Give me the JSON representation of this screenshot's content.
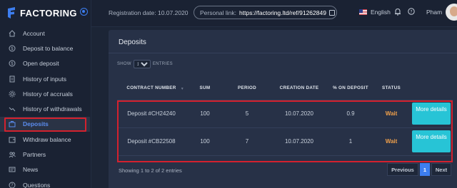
{
  "brand": {
    "name": "FACTORING"
  },
  "sidebar": {
    "items": [
      {
        "label": "Account",
        "icon": "home-icon"
      },
      {
        "label": "Deposit to balance",
        "icon": "dollar-icon"
      },
      {
        "label": "Open deposit",
        "icon": "dollar-icon"
      },
      {
        "label": "History of inputs",
        "icon": "document-icon"
      },
      {
        "label": "History of accruals",
        "icon": "gear-icon"
      },
      {
        "label": "History of withdrawals",
        "icon": "trend-icon"
      },
      {
        "label": "Deposits",
        "icon": "briefcase-icon"
      },
      {
        "label": "Withdraw balance",
        "icon": "wallet-icon"
      },
      {
        "label": "Partners",
        "icon": "users-icon"
      },
      {
        "label": "News",
        "icon": "newspaper-icon"
      },
      {
        "label": "Questions",
        "icon": "question-icon"
      }
    ],
    "active_index": 6
  },
  "topbar": {
    "registration": "Registration date: 10.07.2020",
    "personal_link_label": "Personal link:",
    "personal_link_url": "https://factoring.ltd/ref/91262849",
    "language": "English",
    "user": "Pham"
  },
  "deposits": {
    "title": "Deposits",
    "show_label": "SHOW",
    "show_value": "10",
    "entries_label": "ENTRIES",
    "columns": [
      "CONTRACT NUMBER",
      "SUM",
      "PERIOD",
      "CREATION DATE",
      "% ON DEPOSIT",
      "STATUS"
    ],
    "rows": [
      {
        "contract": "Deposit #CH24240",
        "sum": "100",
        "period": "5",
        "date": "10.07.2020",
        "percent": "0.9",
        "status": "Wait",
        "action": "More details"
      },
      {
        "contract": "Deposit #CB22508",
        "sum": "100",
        "period": "7",
        "date": "10.07.2020",
        "percent": "1",
        "status": "Wait",
        "action": "More details"
      }
    ],
    "info": "Showing 1 to 2 of 2 entries",
    "pagination": {
      "previous": "Previous",
      "page": "1",
      "next": "Next"
    }
  },
  "colors": {
    "accent": "#3d7ef0",
    "button": "#27c4d6",
    "status_wait": "#f0a04b",
    "highlight": "#d4212e"
  }
}
